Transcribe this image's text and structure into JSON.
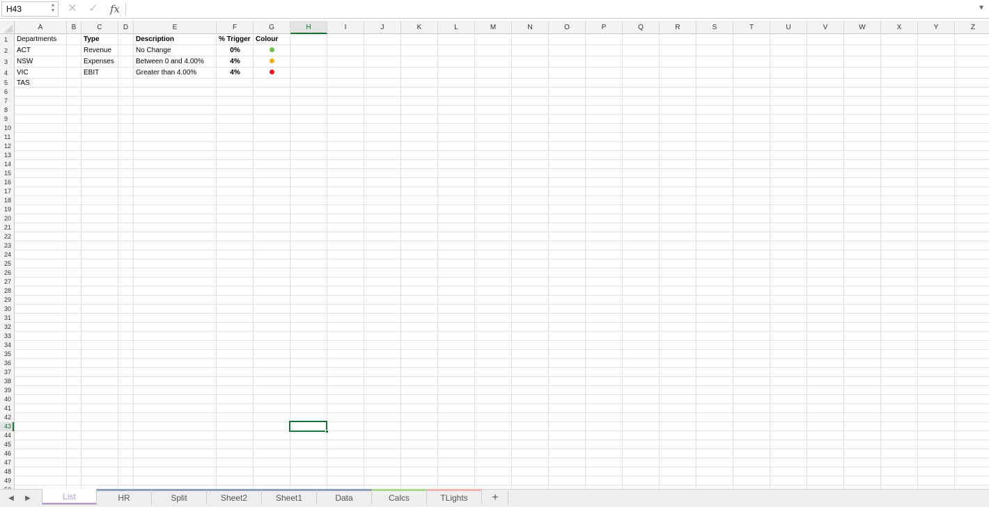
{
  "formula_bar": {
    "name_box": "H43",
    "cancel_icon": "✕",
    "enter_icon": "✓",
    "fx_label": "fx",
    "formula_value": ""
  },
  "columns": [
    "A",
    "B",
    "C",
    "D",
    "E",
    "F",
    "G",
    "H",
    "I",
    "J",
    "K",
    "L",
    "M",
    "N",
    "O",
    "P",
    "Q",
    "R",
    "S",
    "T",
    "U",
    "V",
    "W",
    "X",
    "Y",
    "Z"
  ],
  "active_column": "H",
  "active_row": 43,
  "row_count": 50,
  "cells": {
    "A1": "Departments",
    "A2": "ACT",
    "A3": "NSW",
    "A4": "VIC",
    "A5": "TAS",
    "C1": "Type",
    "C2": "Revenue",
    "C3": "Expenses",
    "C4": "EBIT",
    "E1": "Description",
    "E2": "No Change",
    "E3": "Between 0 and  4.00%",
    "E4": "Greater than  4.00%",
    "F1": "% Trigger",
    "F2": "0%",
    "F3": "4%",
    "F4": "4%",
    "G1": "Colour"
  },
  "traffic_lights": {
    "G2": {
      "icon": "green-dot-icon",
      "color": "#6cc04a"
    },
    "G3": {
      "icon": "amber-dot-icon",
      "color": "#f2b21a"
    },
    "G4": {
      "icon": "red-dot-icon",
      "color": "#e5171c"
    }
  },
  "sheet_tabs": [
    {
      "label": "List",
      "active": true,
      "color": "#b39ad0"
    },
    {
      "label": "HR",
      "active": false,
      "color": "#8ea0bd"
    },
    {
      "label": "Split",
      "active": false,
      "color": "#8ea0bd"
    },
    {
      "label": "Sheet2",
      "active": false,
      "color": "#8ea0bd"
    },
    {
      "label": "Sheet1",
      "active": false,
      "color": "#8ea0bd"
    },
    {
      "label": "Data",
      "active": false,
      "color": "#8ea0bd"
    },
    {
      "label": "Calcs",
      "active": false,
      "color": "#a6d98a"
    },
    {
      "label": "TLights",
      "active": false,
      "color": "#f2b3b3"
    }
  ],
  "add_sheet_label": "+",
  "accent_color": "#1d6f3c"
}
